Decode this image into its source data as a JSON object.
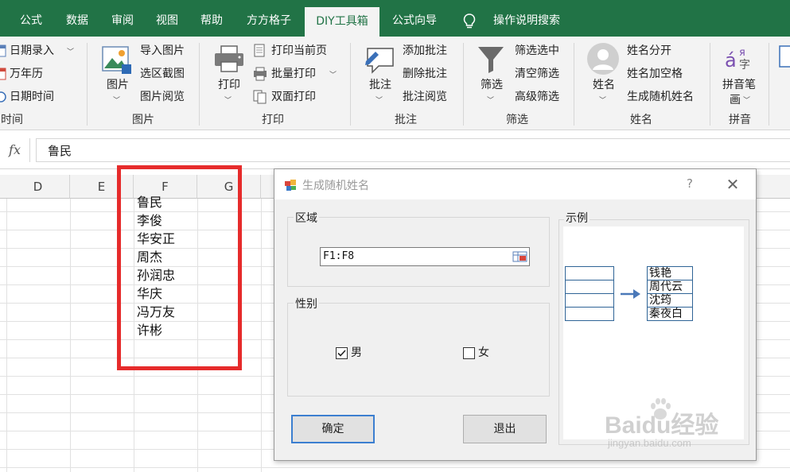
{
  "ribbon": {
    "tabs": [
      {
        "label": "公式",
        "active": false
      },
      {
        "label": "数据",
        "active": false
      },
      {
        "label": "审阅",
        "active": false
      },
      {
        "label": "视图",
        "active": false
      },
      {
        "label": "帮助",
        "active": false
      },
      {
        "label": "方方格子",
        "active": false
      },
      {
        "label": "DIY工具箱",
        "active": true
      },
      {
        "label": "公式向导",
        "active": false
      }
    ],
    "search_label": "操作说明搜索",
    "groups": {
      "time": {
        "label": "时间",
        "items": [
          "日期录入",
          "万年历",
          "日期时间"
        ]
      },
      "picture": {
        "label": "图片",
        "big_button": "图片",
        "items": [
          "导入图片",
          "选区截图",
          "图片阅览"
        ]
      },
      "print": {
        "label": "打印",
        "big_button": "打印",
        "items": [
          "打印当前页",
          "批量打印",
          "双面打印"
        ]
      },
      "comment": {
        "label": "批注",
        "big_button": "批注",
        "items": [
          "添加批注",
          "删除批注",
          "批注阅览"
        ]
      },
      "filter": {
        "label": "筛选",
        "big_button": "筛选",
        "items": [
          "筛选选中",
          "清空筛选",
          "高级筛选"
        ]
      },
      "name": {
        "label": "姓名",
        "big_button": "姓名",
        "items": [
          "姓名分开",
          "姓名加空格",
          "生成随机姓名"
        ]
      },
      "pinyin": {
        "label": "拼音",
        "big_button_line1": "拼音笔",
        "big_button_line2": "画"
      }
    }
  },
  "formula_bar": {
    "fx_label": "fx",
    "value": "鲁民"
  },
  "sheet": {
    "columns": [
      "D",
      "E",
      "F",
      "G"
    ],
    "f_column_values": [
      "鲁民",
      "李俊",
      "华安正",
      "周杰",
      "孙润忠",
      "华庆",
      "冯万友",
      "许彬"
    ]
  },
  "dialog": {
    "title": "生成随机姓名",
    "help": "?",
    "close": "✕",
    "range_label": "区域",
    "range_value": "F1:F8",
    "gender_label": "性别",
    "male_label": "男",
    "male_checked": true,
    "female_label": "女",
    "female_checked": false,
    "ok_label": "确定",
    "exit_label": "退出",
    "example_label": "示例",
    "example_names": [
      "钱艳",
      "周代云",
      "沈筠",
      "秦夜白"
    ]
  },
  "watermark": {
    "brand": "Baidu经验",
    "url": "jingyan.baidu.com"
  },
  "colors": {
    "excel_green": "#217346",
    "highlight_red": "#e62b2b",
    "button_focus": "#3c7fd0"
  }
}
